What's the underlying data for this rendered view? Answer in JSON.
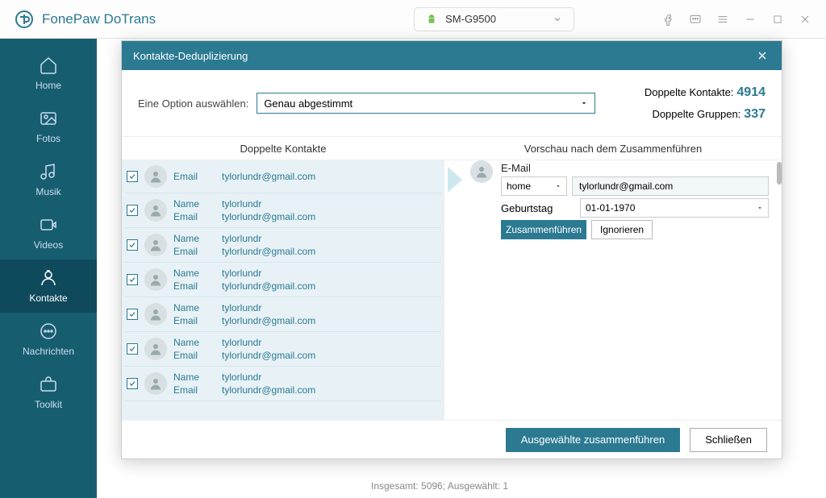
{
  "titlebar": {
    "brand": "FonePaw DoTrans",
    "device": "SM-G9500"
  },
  "sidebar": {
    "items": [
      {
        "label": "Home"
      },
      {
        "label": "Fotos"
      },
      {
        "label": "Musik"
      },
      {
        "label": "Videos"
      },
      {
        "label": "Kontakte"
      },
      {
        "label": "Nachrichten"
      },
      {
        "label": "Toolkit"
      }
    ]
  },
  "modal": {
    "title": "Kontakte-Deduplizierung",
    "option_label": "Eine Option auswählen:",
    "option_value": "Genau abgestimmt",
    "stats": {
      "contacts_label": "Doppelte Kontakte:",
      "contacts_val": "4914",
      "groups_label": "Doppelte Gruppen:",
      "groups_val": "337"
    },
    "col_left": "Doppelte Kontakte",
    "col_right": "Vorschau nach dem Zusammenführen",
    "field_name": "Name",
    "field_email": "Email",
    "contacts": [
      {
        "name": "",
        "email": "tylorlundr@gmail.com"
      },
      {
        "name": "tylorlundr",
        "email": "tylorlundr@gmail.com"
      },
      {
        "name": "tylorlundr",
        "email": "tylorlundr@gmail.com"
      },
      {
        "name": "tylorlundr",
        "email": "tylorlundr@gmail.com"
      },
      {
        "name": "tylorlundr",
        "email": "tylorlundr@gmail.com"
      },
      {
        "name": "tylorlundr",
        "email": "tylorlundr@gmail.com"
      },
      {
        "name": "tylorlundr",
        "email": "tylorlundr@gmail.com"
      }
    ],
    "preview": {
      "email_label": "E-Mail",
      "email_type": "home",
      "email_val": "tylorlundr@gmail.com",
      "bday_label": "Geburtstag",
      "bday_val": "01-01-1970",
      "merge_btn": "Zusammenführen",
      "ignore_btn": "Ignorieren"
    },
    "footer": {
      "merge_sel": "Ausgewählte zusammenführen",
      "close": "Schließen"
    }
  },
  "status": "Insgesamt: 5096; Ausgewählt: 1"
}
